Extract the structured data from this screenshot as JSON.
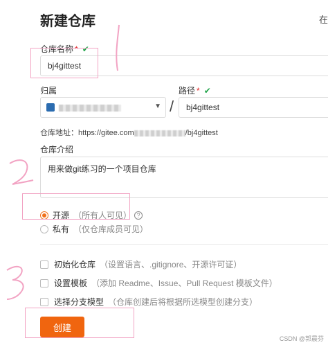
{
  "header": {
    "title": "新建仓库",
    "top_right": "在"
  },
  "repo_name": {
    "label": "仓库名称",
    "required_mark": "*",
    "check_mark": "✔",
    "value": "bj4gittest"
  },
  "owner": {
    "label": "归属",
    "caret": "▼"
  },
  "path": {
    "label": "路径",
    "required_mark": "*",
    "check_mark": "✔",
    "separator": "/",
    "value": "bj4gittest"
  },
  "address": {
    "prefix": "仓库地址：https://gitee.com",
    "suffix": "/bj4gittest"
  },
  "intro": {
    "label": "仓库介绍",
    "value": "用来做git练习的一个项目仓库"
  },
  "visibility": {
    "public_label": "开源",
    "public_hint": "（所有人可见）",
    "help_glyph": "?",
    "private_label": "私有",
    "private_hint": "（仅仓库成员可见）",
    "selected": "public"
  },
  "options": [
    {
      "label": "初始化仓库",
      "hint": "（设置语言、.gitignore、开源许可证）",
      "checked": false
    },
    {
      "label": "设置模板",
      "hint": "（添加 Readme、Issue、Pull Request 模板文件）",
      "checked": false
    },
    {
      "label": "选择分支模型",
      "hint": "（仓库创建后将根据所选模型创建分支）",
      "checked": false
    }
  ],
  "create_button": {
    "label": "创建"
  },
  "watermark": "CSDN @郭晨芬",
  "colors": {
    "accent": "#f0650f",
    "success": "#21a44a",
    "required": "#e02020",
    "annotation": "#f2a3c3"
  }
}
